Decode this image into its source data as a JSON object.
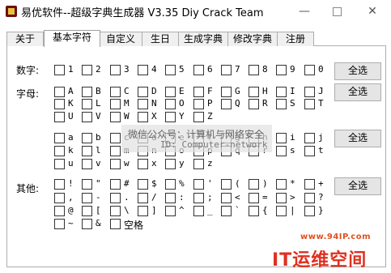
{
  "window": {
    "title": "易优软件--超级字典生成器 V3.35  Diy Crack Team",
    "minimize": "—",
    "close": "✕"
  },
  "tabs": [
    "关于",
    "基本字符",
    "自定义",
    "生日",
    "生成字典",
    "修改字典",
    "注册"
  ],
  "labels": {
    "digits": "数字:",
    "letters": "字母:",
    "others": "其他:"
  },
  "select_all": "全选",
  "chars": {
    "digits": [
      "1",
      "2",
      "3",
      "4",
      "5",
      "6",
      "7",
      "8",
      "9",
      "0"
    ],
    "upper_row1": [
      "A",
      "B",
      "C",
      "D",
      "E",
      "F",
      "G",
      "H",
      "I",
      "J"
    ],
    "upper_row2": [
      "K",
      "L",
      "M",
      "N",
      "O",
      "P",
      "Q",
      "R",
      "S",
      "T"
    ],
    "upper_row3": [
      "U",
      "V",
      "W",
      "X",
      "Y",
      "Z"
    ],
    "lower_row1": [
      "a",
      "b",
      "c",
      "d",
      "e",
      "f",
      "g",
      "h",
      "i",
      "j"
    ],
    "lower_row2": [
      "k",
      "l",
      "m",
      "n",
      "o",
      "p",
      "q",
      "r",
      "s",
      "t"
    ],
    "lower_row3": [
      "u",
      "v",
      "w",
      "x",
      "y",
      "z"
    ],
    "sym_row1": [
      "!",
      "\"",
      "#",
      "$",
      "%",
      "'",
      "(",
      ")",
      "*",
      "+"
    ],
    "sym_row2": [
      ",",
      "-",
      ".",
      "/",
      ":",
      ";",
      "<",
      "=",
      ">",
      "?"
    ],
    "sym_row3": [
      "@",
      "[",
      "\\",
      "]",
      "^",
      "_",
      "`",
      "{",
      "|",
      "}"
    ],
    "sym_row4": [
      "~",
      "&",
      "空格"
    ]
  },
  "watermark": {
    "line1": "微信公众号：计算机与网络安全",
    "line2": "ID: Computer-network"
  },
  "site": {
    "url": "www.94IP.com",
    "brand_it": "IT",
    "brand_rest": "运维空间"
  }
}
